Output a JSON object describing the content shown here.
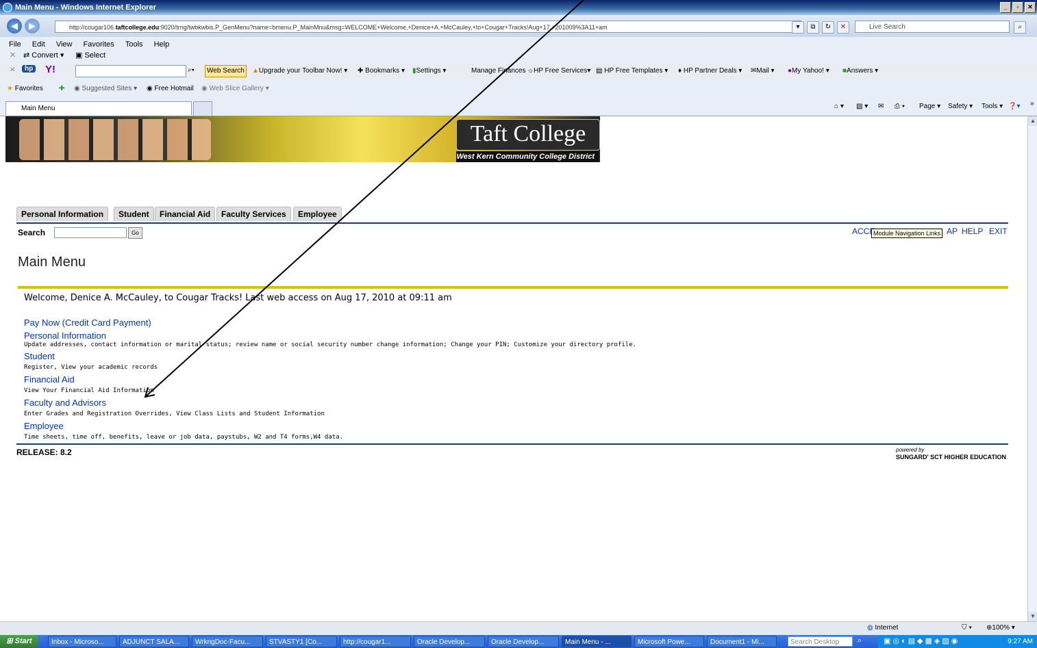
{
  "window": {
    "title": "Main Menu - Windows Internet Explorer"
  },
  "browser": {
    "url_prefix": "http://cougar106.",
    "url_domain": "taftcollege.edu",
    "url_rest": ":9020/trng/twbkwbis.P_GenMenu?name=bmenu.P_MainMnu&msg=WELCOME+Welcome,+Denice+A.+McCauley,+to+Cougar+Tracks!Aug+17,+201009%3A11+am",
    "live_search_placeholder": "Live Search",
    "menu": [
      "File",
      "Edit",
      "View",
      "Favorites",
      "Tools",
      "Help"
    ],
    "toolbar_row3": {
      "convert": "Convert",
      "select": "Select"
    },
    "toolbar_row4": {
      "web_search": "Web Search",
      "upgrade": "Upgrade your Toolbar Now!",
      "bookmarks": "Bookmarks",
      "settings": "Settings",
      "manage_finances": "Manage Finances",
      "hp_free_services": "HP Free Services",
      "hp_free_templates": "HP Free Templates",
      "hp_partner_deals": "HP Partner Deals",
      "mail": "Mail",
      "my_yahoo": "My Yahoo!",
      "answers": "Answers"
    },
    "favorites_bar": {
      "favorites": "Favorites",
      "suggested_sites": "Suggested Sites",
      "free_hotmail": "Free Hotmail",
      "web_slice_gallery": "Web Slice Gallery"
    },
    "tab_title": "Main Menu",
    "command_bar": {
      "page": "Page",
      "safety": "Safety",
      "tools": "Tools"
    }
  },
  "banner": {
    "logo_text": "Taft College",
    "subtitle": "West Kern Community College District"
  },
  "nav_tabs": [
    "Personal Information",
    "Student",
    "Financial Aid",
    "Faculty Services",
    "Employee"
  ],
  "search": {
    "label": "Search",
    "go": "Go"
  },
  "top_links": {
    "accessibility_start": "ACCE",
    "sitemap_end": "AP",
    "help": "HELP",
    "exit": "EXIT"
  },
  "tooltip": "Module Navigation Links",
  "main_title": "Main Menu",
  "welcome": "Welcome, Denice A. McCauley, to Cougar Tracks! Last web access on Aug 17, 2010 at 09:11 am",
  "menu_items": [
    {
      "label": "Pay Now (Credit Card Payment)",
      "desc": ""
    },
    {
      "label": "Personal Information",
      "desc": "Update addresses, contact information or marital status; review name or social security number change information; Change your PIN; Customize your directory profile."
    },
    {
      "label": "Student",
      "desc": "Register, View your academic records"
    },
    {
      "label": "Financial Aid",
      "desc": "View Your Financial Aid Information"
    },
    {
      "label": "Faculty and Advisors",
      "desc": "Enter Grades and Registration Overrides, View Class Lists and Student Information"
    },
    {
      "label": "Employee",
      "desc": "Time sheets, time off, benefits, leave or job data, paystubs, W2 and T4 forms,W4 data."
    }
  ],
  "release": "RELEASE: 8.2",
  "powered_by": "powered by",
  "sungard": "SUNGARD' SCT HIGHER EDUCATION",
  "status": {
    "zone": "Internet",
    "zoom": "100%"
  },
  "taskbar": {
    "start": "Start",
    "tasks": [
      "Inbox - Microso...",
      "ADJUNCT SALA...",
      "WrkngDoc-Facu...",
      "STVASTY1 [Co...",
      "http://cougar1...",
      "Oracle Develop...",
      "Oracle Develop...",
      "Main Menu - ...",
      "Microsoft Powe...",
      "Document1 - Mi..."
    ],
    "search_placeholder": "Search Desktop",
    "clock": "9:27 AM"
  },
  "colors": {
    "link": "#0033cc",
    "nav_line": "#1c3c6e",
    "accent_line": "#d4c400"
  }
}
